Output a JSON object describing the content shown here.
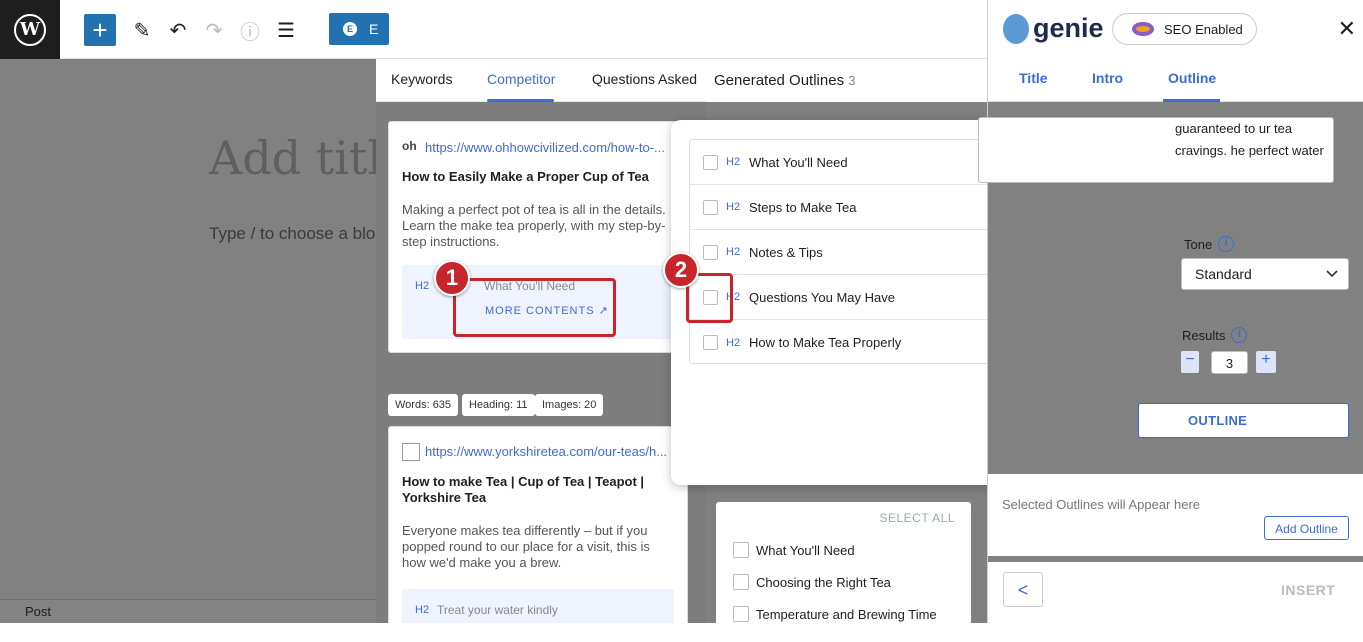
{
  "toolbar": {
    "wp_logo": "W",
    "add_icon": "+",
    "pen_icon": "✎",
    "undo_icon": "↶",
    "redo_icon": "↷",
    "info_icon": "ⓘ",
    "list_icon": "☰",
    "elementor_label": "E"
  },
  "editor": {
    "title_placeholder": "Add title",
    "block_placeholder": "Type / to choose a block",
    "footer_label": "Post"
  },
  "competitor_panel": {
    "tabs": [
      "Keywords",
      "Competitor",
      "Questions Asked"
    ],
    "active_tab": "Competitor",
    "card1": {
      "favicon": "oh",
      "url": "https://www.ohhowcivilized.com/how-to-...",
      "title": "How to Easily Make a Proper Cup of Tea",
      "description": "Making a perfect pot of tea is all in the details. Learn the make tea properly, with my step-by-step instructions.",
      "h2_label": "H2",
      "h2_text": "What You'll Need",
      "more_label": "MORE CONTENTS"
    },
    "stats": [
      "Words: 635",
      "Heading: 11",
      "Images: 20"
    ],
    "card2": {
      "url": "https://www.yorkshiretea.com/our-teas/h...",
      "title": "How to make Tea | Cup of Tea | Teapot | Yorkshire Tea",
      "description": "Everyone makes tea differently – but if you popped round to our place for a visit, this is how we'd make you a brew.",
      "h2_label": "H2",
      "h2_text": "Treat your water kindly"
    }
  },
  "generated": {
    "label": "Generated Outlines",
    "count": "3",
    "select_all": "SELECT ALL",
    "items": [
      "What You'll Need",
      "Choosing the Right Tea",
      "Temperature and Brewing Time"
    ]
  },
  "popup": {
    "rows": [
      {
        "tag": "H2",
        "title": "What You'll Need"
      },
      {
        "tag": "H2",
        "title": "Steps to Make Tea"
      },
      {
        "tag": "H2",
        "title": "Notes & Tips"
      },
      {
        "tag": "H2",
        "title": "Questions You May Have"
      },
      {
        "tag": "H2",
        "title": "How to Make Tea Properly"
      }
    ]
  },
  "annotations": {
    "badge1": "1",
    "badge2": "2"
  },
  "genie": {
    "logo_text": "genie",
    "seo_badge": "SEO Enabled",
    "close_icon": "✕",
    "tabs": [
      "Title",
      "Intro",
      "Outline"
    ],
    "active_tab": "Outline",
    "intro_text": "guaranteed to ur tea cravings. he perfect water",
    "tone_label": "Tone",
    "tone_value": "Standard",
    "results_label": "Results",
    "results_value": "3",
    "minus": "−",
    "plus": "+",
    "outline_button": "OUTLINE",
    "selected_text": "Selected Outlines will Appear here",
    "add_outline": "Add Outline",
    "back_icon": "<",
    "insert_label": "INSERT"
  },
  "colors": {
    "accent": "#3e6ad8",
    "wp_blue": "#2271b1",
    "annotation": "#c7252c"
  }
}
